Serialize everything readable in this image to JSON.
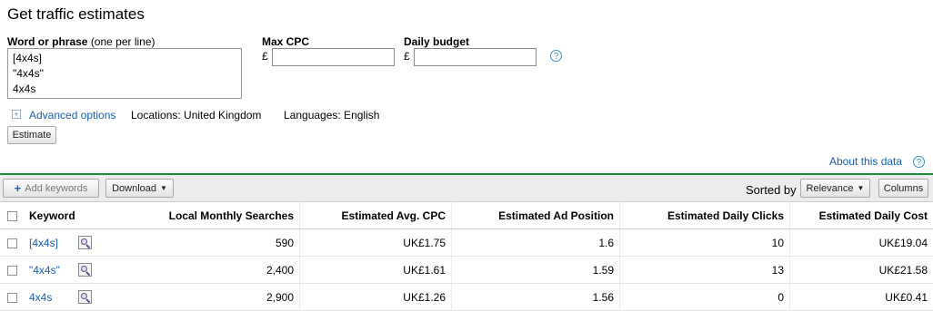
{
  "page_title": "Get traffic estimates",
  "form": {
    "keyword_label": "Word or phrase",
    "keyword_hint": "(one per line)",
    "keywords_lines": [
      "[4x4s]",
      "\"4x4s\"",
      "4x4s"
    ],
    "max_cpc_label": "Max CPC",
    "daily_budget_label": "Daily budget",
    "currency_symbol": "£",
    "max_cpc_value": "",
    "daily_budget_value": "",
    "help_icon": "?",
    "advanced_options": "Advanced options",
    "locations": "Locations: United Kingdom",
    "languages": "Languages: English",
    "estimate_button": "Estimate"
  },
  "about_link": "About this data",
  "toolbar": {
    "add_keywords": "Add keywords",
    "download": "Download",
    "sorted_by_label": "Sorted by",
    "sort_value": "Relevance",
    "columns_button": "Columns"
  },
  "table": {
    "headers": [
      "Keyword",
      "Local Monthly Searches",
      "Estimated Avg. CPC",
      "Estimated Ad Position",
      "Estimated Daily Clicks",
      "Estimated Daily Cost"
    ],
    "rows": [
      {
        "keyword": "[4x4s]",
        "searches": "590",
        "cpc": "UK£1.75",
        "position": "1.6",
        "clicks": "10",
        "cost": "UK£19.04"
      },
      {
        "keyword": "\"4x4s\"",
        "searches": "2,400",
        "cpc": "UK£1.61",
        "position": "1.59",
        "clicks": "13",
        "cost": "UK£21.58"
      },
      {
        "keyword": "4x4s",
        "searches": "2,900",
        "cpc": "UK£1.26",
        "position": "1.56",
        "clicks": "0",
        "cost": "UK£0.41"
      }
    ]
  },
  "colors": {
    "accent_green": "#1e8a3c",
    "link_blue": "#1a5fb4"
  }
}
